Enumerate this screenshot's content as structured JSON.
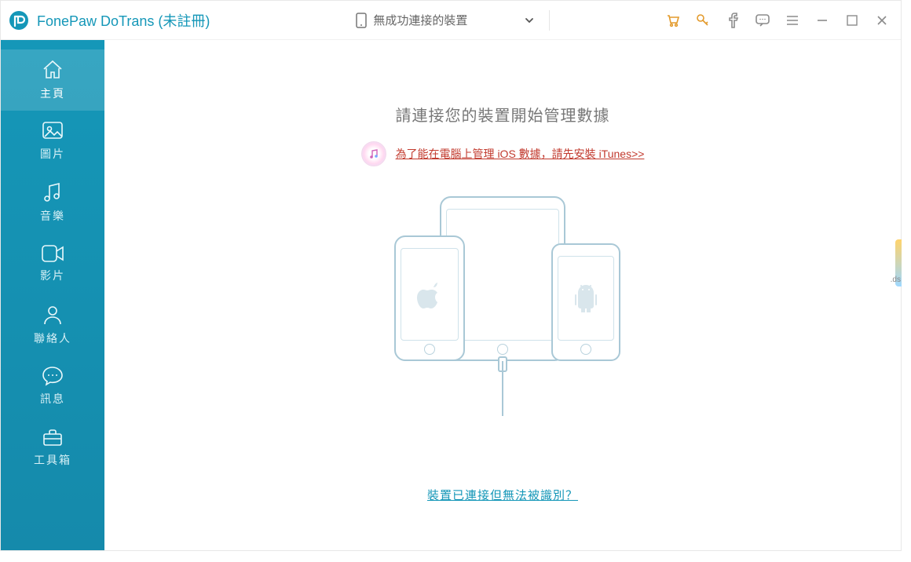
{
  "app_title": "FonePaw DoTrans (未註冊)",
  "device_selector": {
    "label": "無成功連接的裝置"
  },
  "top_icons": {
    "cart": "cart-icon",
    "key": "key-icon",
    "facebook": "facebook-icon",
    "feedback": "feedback-icon",
    "menu": "menu-icon",
    "minimize": "minimize-icon",
    "maximize": "maximize-icon",
    "close": "close-icon"
  },
  "sidebar": {
    "items": [
      {
        "id": "home",
        "label": "主頁",
        "active": true
      },
      {
        "id": "photos",
        "label": "圖片",
        "active": false
      },
      {
        "id": "music",
        "label": "音樂",
        "active": false
      },
      {
        "id": "videos",
        "label": "影片",
        "active": false
      },
      {
        "id": "contacts",
        "label": "聯絡人",
        "active": false
      },
      {
        "id": "messages",
        "label": "訊息",
        "active": false
      },
      {
        "id": "toolbox",
        "label": "工具箱",
        "active": false
      }
    ]
  },
  "main": {
    "title": "請連接您的裝置開始管理數據",
    "itunes_note": "為了能在電腦上管理 iOS 數據，請先安裝 iTunes>>",
    "help_link": "裝置已連接但無法被識別？"
  },
  "peek_label": ".ds"
}
